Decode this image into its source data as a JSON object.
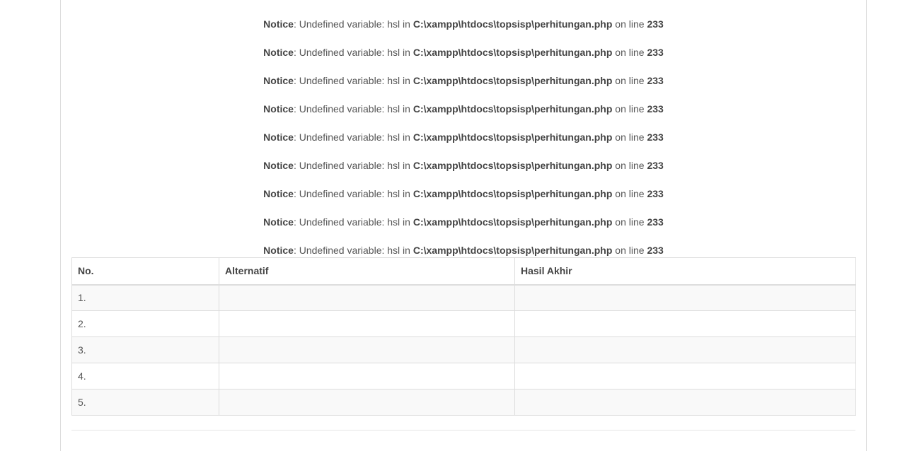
{
  "notices": [
    {
      "label": "Notice",
      "message": ": Undefined variable: hsl in ",
      "file": "C:\\xampp\\htdocs\\topsisp\\perhitungan.php",
      "on_line": " on line ",
      "line": "233"
    },
    {
      "label": "Notice",
      "message": ": Undefined variable: hsl in ",
      "file": "C:\\xampp\\htdocs\\topsisp\\perhitungan.php",
      "on_line": " on line ",
      "line": "233"
    },
    {
      "label": "Notice",
      "message": ": Undefined variable: hsl in ",
      "file": "C:\\xampp\\htdocs\\topsisp\\perhitungan.php",
      "on_line": " on line ",
      "line": "233"
    },
    {
      "label": "Notice",
      "message": ": Undefined variable: hsl in ",
      "file": "C:\\xampp\\htdocs\\topsisp\\perhitungan.php",
      "on_line": " on line ",
      "line": "233"
    },
    {
      "label": "Notice",
      "message": ": Undefined variable: hsl in ",
      "file": "C:\\xampp\\htdocs\\topsisp\\perhitungan.php",
      "on_line": " on line ",
      "line": "233"
    },
    {
      "label": "Notice",
      "message": ": Undefined variable: hsl in ",
      "file": "C:\\xampp\\htdocs\\topsisp\\perhitungan.php",
      "on_line": " on line ",
      "line": "233"
    },
    {
      "label": "Notice",
      "message": ": Undefined variable: hsl in ",
      "file": "C:\\xampp\\htdocs\\topsisp\\perhitungan.php",
      "on_line": " on line ",
      "line": "233"
    },
    {
      "label": "Notice",
      "message": ": Undefined variable: hsl in ",
      "file": "C:\\xampp\\htdocs\\topsisp\\perhitungan.php",
      "on_line": " on line ",
      "line": "233"
    },
    {
      "label": "Notice",
      "message": ": Undefined variable: hsl in ",
      "file": "C:\\xampp\\htdocs\\topsisp\\perhitungan.php",
      "on_line": " on line ",
      "line": "233"
    }
  ],
  "table": {
    "headers": [
      "No.",
      "Alternatif",
      "Hasil Akhir"
    ],
    "rows": [
      [
        "1.",
        "",
        ""
      ],
      [
        "2.",
        "",
        ""
      ],
      [
        "3.",
        "",
        ""
      ],
      [
        "4.",
        "",
        ""
      ],
      [
        "5.",
        "",
        ""
      ]
    ]
  },
  "colors": {
    "text": "#555555",
    "border": "#dddddd",
    "stripe": "#f9f9f9"
  }
}
